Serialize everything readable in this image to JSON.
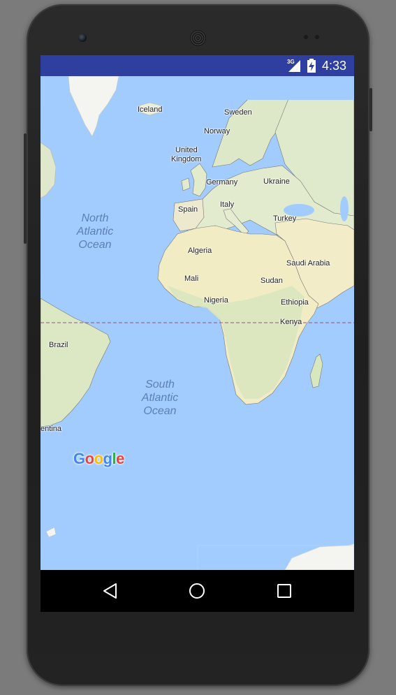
{
  "status_bar": {
    "time": "4:33",
    "network": "3G",
    "icons": [
      "signal-icon",
      "battery-charging-icon"
    ],
    "color": "#2e3f9f"
  },
  "map": {
    "ocean_color": "#a3ccfe",
    "land_color": "#e9eedb",
    "equator_color": "#8a5a7a",
    "oceans": [
      "North Atlantic Ocean",
      "South Atlantic Ocean"
    ],
    "labels": {
      "iceland": "Iceland",
      "sweden": "Sweden",
      "norway": "Norway",
      "united_kingdom_1": "United",
      "united_kingdom_2": "Kingdom",
      "germany": "Germany",
      "ukraine": "Ukraine",
      "spain": "Spain",
      "italy": "Italy",
      "turkey": "Turkey",
      "algeria": "Algeria",
      "saudi_arabia": "Saudi Arabia",
      "mali": "Mali",
      "sudan": "Sudan",
      "nigeria": "Nigeria",
      "ethiopia": "Ethiopia",
      "kenya": "Kenya",
      "brazil": "Brazil",
      "argentina_partial": "entina",
      "north_atlantic_1": "North",
      "north_atlantic_2": "Atlantic",
      "north_atlantic_3": "Ocean",
      "south_atlantic_1": "South",
      "south_atlantic_2": "Atlantic",
      "south_atlantic_3": "Ocean"
    },
    "attribution": "Google"
  },
  "nav_bar": {
    "buttons": [
      "back-icon",
      "home-icon",
      "recents-icon"
    ]
  }
}
